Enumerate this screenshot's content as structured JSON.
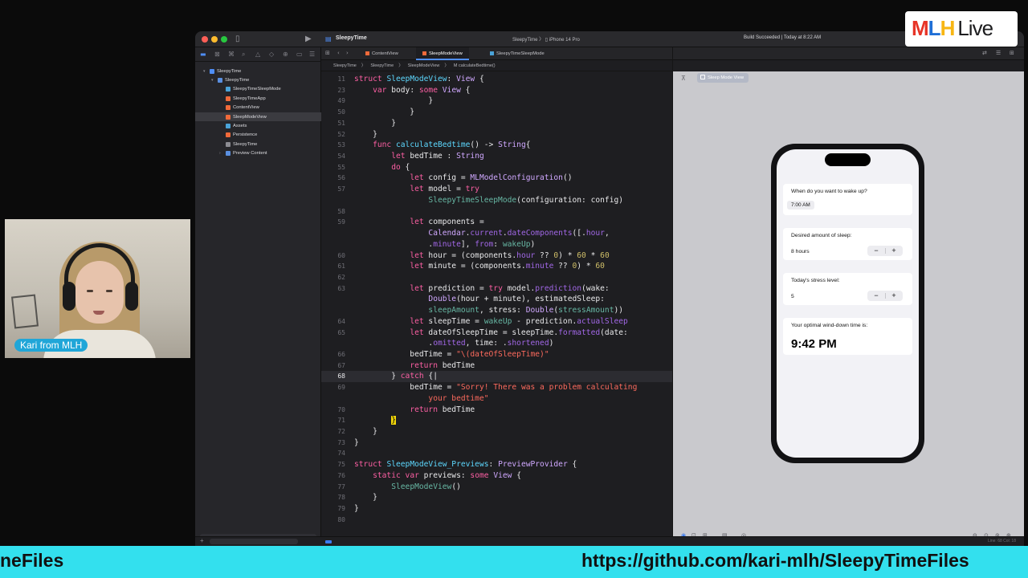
{
  "window": {
    "app_title": "SleepyTime",
    "scheme": "SleepyTime 〉 ▯ iPhone 14 Pro",
    "build_status": "Build Succeeded | Today at 8:22 AM"
  },
  "navigator": {
    "items": [
      {
        "label": "SleepyTime",
        "level": 0,
        "icon": "project-icon",
        "chevron": "▾"
      },
      {
        "label": "SleepyTime",
        "level": 1,
        "icon": "folder-icon",
        "chevron": "▾"
      },
      {
        "label": "SleepyTimeSleepMode",
        "level": 2,
        "icon": "mlmodel-icon"
      },
      {
        "label": "SleepyTimeApp",
        "level": 2,
        "icon": "swift-file-icon"
      },
      {
        "label": "ContentView",
        "level": 2,
        "icon": "swift-file-icon"
      },
      {
        "label": "SleepModeView",
        "level": 2,
        "icon": "swift-file-icon",
        "selected": true
      },
      {
        "label": "Assets",
        "level": 2,
        "icon": "assets-icon"
      },
      {
        "label": "Persistence",
        "level": 2,
        "icon": "swift-file-icon"
      },
      {
        "label": "SleepyTime",
        "level": 2,
        "icon": "file-icon"
      },
      {
        "label": "Preview Content",
        "level": 2,
        "icon": "folder-icon",
        "chevron": "›"
      }
    ]
  },
  "tabs": [
    {
      "label": "ContentView"
    },
    {
      "label": "SleepModeView",
      "active": true
    },
    {
      "label": "SleepyTimeSleepMode"
    }
  ],
  "jumpbar": [
    "SleepyTime",
    "〉",
    "SleepyTime",
    "〉",
    "SleepModeView",
    "〉",
    "M calculateBedtime()"
  ],
  "code": {
    "current_line": "68",
    "lines": [
      {
        "n": "11",
        "html": "<span class='kw'>struct</span> <span class='user'>SleepModeView</span>: <span class='typ'>View</span> {"
      },
      {
        "n": "23",
        "html": "    <span class='kw'>var</span> body: <span class='kw'>some</span> <span class='typ'>View</span> {"
      },
      {
        "n": "49",
        "html": "                }"
      },
      {
        "n": "50",
        "html": "            }"
      },
      {
        "n": "51",
        "html": "        }"
      },
      {
        "n": "52",
        "html": "    }"
      },
      {
        "n": "53",
        "html": "    <span class='kw'>func</span> <span class='user'>calculateBedtime</span>() -> <span class='typ'>String</span>{"
      },
      {
        "n": "54",
        "html": "        <span class='kw'>let</span> bedTime : <span class='typ'>String</span>"
      },
      {
        "n": "55",
        "html": "        <span class='kw'>do</span> {"
      },
      {
        "n": "56",
        "html": "            <span class='kw'>let</span> config = <span class='typ'>MLModelConfiguration</span>()"
      },
      {
        "n": "57",
        "html": "            <span class='kw'>let</span> model = <span class='kw'>try</span>"
      },
      {
        "n": "",
        "html": "                <span class='fn'>SleepyTimeSleepMode</span>(configuration: config)"
      },
      {
        "n": "58",
        "html": ""
      },
      {
        "n": "59",
        "html": "            <span class='kw'>let</span> components ="
      },
      {
        "n": "",
        "html": "                <span class='typ'>Calendar</span>.<span class='prop'>current</span>.<span class='prop'>dateComponents</span>([.<span class='prop'>hour</span>,"
      },
      {
        "n": "",
        "html": "                .<span class='prop'>minute</span>], <span class='prop'>from</span>: <span class='fn'>wakeUp</span>)"
      },
      {
        "n": "60",
        "html": "            <span class='kw'>let</span> hour = (components.<span class='prop'>hour</span> ?? <span class='num'>0</span>) * <span class='num'>60</span> * <span class='num'>60</span>"
      },
      {
        "n": "61",
        "html": "            <span class='kw'>let</span> minute = (components.<span class='prop'>minute</span> ?? <span class='num'>0</span>) * <span class='num'>60</span>"
      },
      {
        "n": "62",
        "html": ""
      },
      {
        "n": "63",
        "html": "            <span class='kw'>let</span> prediction = <span class='kw'>try</span> model.<span class='prop'>prediction</span>(wake:"
      },
      {
        "n": "",
        "html": "                <span class='typ'>Double</span>(hour + minute), estimatedSleep:"
      },
      {
        "n": "",
        "html": "                <span class='fn'>sleepAmount</span>, stress: <span class='typ'>Double</span>(<span class='fn'>stressAmount</span>))"
      },
      {
        "n": "64",
        "html": "            <span class='kw'>let</span> sleepTime = <span class='fn'>wakeUp</span> - prediction.<span class='prop'>actualSleep</span>"
      },
      {
        "n": "65",
        "html": "            <span class='kw'>let</span> dateOfSleepTime = sleepTime.<span class='prop'>formatted</span>(date:"
      },
      {
        "n": "",
        "html": "                .<span class='prop'>omitted</span>, time: .<span class='prop'>shortened</span>)"
      },
      {
        "n": "66",
        "html": "            bedTime = <span class='str'>\"\\(dateOfSleepTime)\"</span>"
      },
      {
        "n": "67",
        "html": "            <span class='kw'>return</span> bedTime"
      },
      {
        "n": "68",
        "html": "        } <span class='kw'>catch</span> {|"
      },
      {
        "n": "69",
        "html": "            bedTime = <span class='str'>\"Sorry! There was a problem calculating</span>"
      },
      {
        "n": "",
        "html": "                <span class='str'>your bedtime\"</span>"
      },
      {
        "n": "70",
        "html": "            <span class='kw'>return</span> bedTime"
      },
      {
        "n": "71",
        "html": "        <span class='brace-hl'>}</span>"
      },
      {
        "n": "72",
        "html": "    }"
      },
      {
        "n": "73",
        "html": "}"
      },
      {
        "n": "74",
        "html": ""
      },
      {
        "n": "75",
        "html": "<span class='kw'>struct</span> <span class='user'>SleepModeView_Previews</span>: <span class='typ'>PreviewProvider</span> {"
      },
      {
        "n": "76",
        "html": "    <span class='kw'>static</span> <span class='kw'>var</span> previews: <span class='kw'>some</span> <span class='typ'>View</span> {"
      },
      {
        "n": "77",
        "html": "        <span class='fn'>SleepModeView</span>()"
      },
      {
        "n": "78",
        "html": "    }"
      },
      {
        "n": "79",
        "html": "}"
      },
      {
        "n": "80",
        "html": ""
      }
    ]
  },
  "preview": {
    "chip_label": "Sleep Mode View",
    "wake_label": "When do you want to wake up?",
    "wake_value": "7:00 AM",
    "sleep_label": "Desired amount of sleep:",
    "sleep_value": "8 hours",
    "stress_label": "Today's stress level:",
    "stress_value": "5",
    "result_label": "Your optimal wind-down time is:",
    "result_value": "9:42 PM",
    "minus": "−",
    "plus": "+"
  },
  "webcam": {
    "name_tag": "Kari from MLH"
  },
  "logo": {
    "m": "M",
    "l": "L",
    "h": "H",
    "live": "Live"
  },
  "banner": {
    "left_text": "neFiles",
    "url": "https://github.com/kari-mlh/SleepyTimeFiles"
  },
  "statusbar": {
    "position": "Line: 68  Col: 18"
  }
}
